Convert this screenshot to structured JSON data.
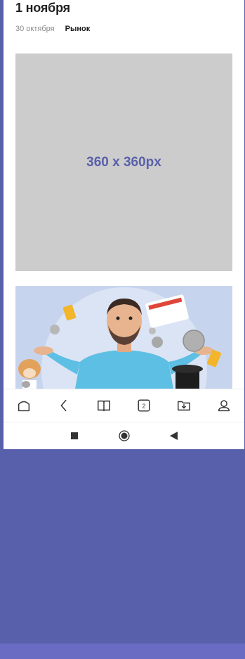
{
  "article": {
    "title": "1 ноября",
    "date": "30 октября",
    "tag": "Рынок"
  },
  "placeholder_image": {
    "label": "360 x 360px"
  },
  "bottom_nav": {
    "tab_count": "2",
    "items": [
      "home-icon",
      "back-icon",
      "book-icon",
      "tabs-icon",
      "download-folder-icon",
      "profile-icon"
    ]
  },
  "system_nav": [
    "square-icon",
    "circle-icon",
    "back-triangle-icon"
  ],
  "colors": {
    "background": "#5960ab",
    "accent": "#5960ab",
    "placeholder": "#cccccc",
    "bottom_strip": "#6a6cc4"
  }
}
